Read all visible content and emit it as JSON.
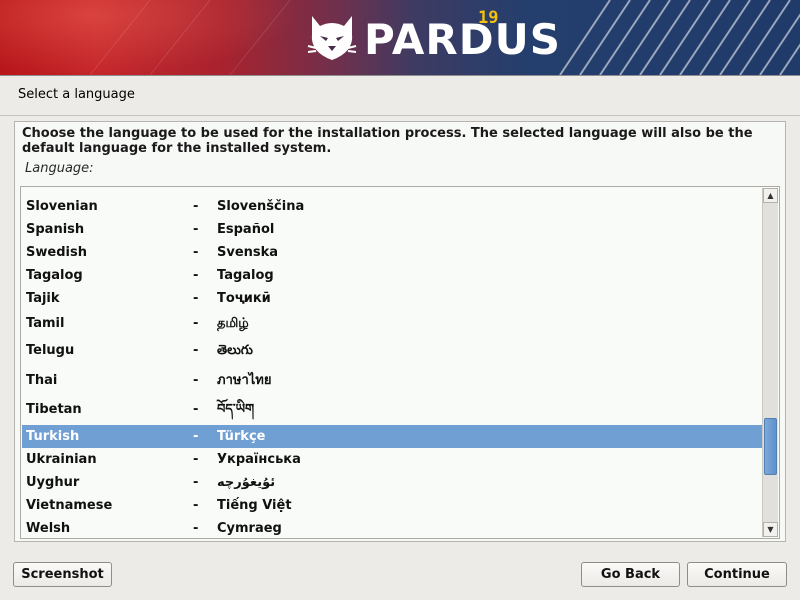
{
  "banner": {
    "logo_text": "PARDUS",
    "logo_version": "19"
  },
  "page": {
    "title": "Select a language"
  },
  "content": {
    "description": "Choose the language to be used for the installation process. The selected language will also be the default language for the installed system.",
    "list_label": "Language:"
  },
  "languages": [
    {
      "en": "Slovenian",
      "native": "Slovenščina"
    },
    {
      "en": "Spanish",
      "native": "Español"
    },
    {
      "en": "Swedish",
      "native": "Svenska"
    },
    {
      "en": "Tagalog",
      "native": "Tagalog"
    },
    {
      "en": "Tajik",
      "native": "Тоҷикӣ"
    },
    {
      "en": "Tamil",
      "native": "தமிழ்"
    },
    {
      "en": "Telugu",
      "native": "తెలుగు"
    },
    {
      "en": "Thai",
      "native": "ภาษาไทย"
    },
    {
      "en": "Tibetan",
      "native": "བོད་ཡིག"
    },
    {
      "en": "Turkish",
      "native": "Türkçe"
    },
    {
      "en": "Ukrainian",
      "native": "Українська"
    },
    {
      "en": "Uyghur",
      "native": "ئۇيغۇرچە"
    },
    {
      "en": "Vietnamese",
      "native": "Tiếng Việt"
    },
    {
      "en": "Welsh",
      "native": "Cymraeg"
    }
  ],
  "separator": "-",
  "selected_language": "Turkish",
  "scroll": {
    "position_fraction": 0.82,
    "visible_fraction": 0.18
  },
  "buttons": {
    "screenshot": "Screenshot",
    "back": "Go Back",
    "continue": "Continue"
  },
  "icons": {
    "logo_mark": "pardus-lynx-icon",
    "scroll_up": "arrow-up-icon",
    "scroll_down": "arrow-down-icon"
  },
  "colors": {
    "selection": "#6f9fd3",
    "logo_version": "#f2c20e",
    "background": "#edebe7"
  }
}
